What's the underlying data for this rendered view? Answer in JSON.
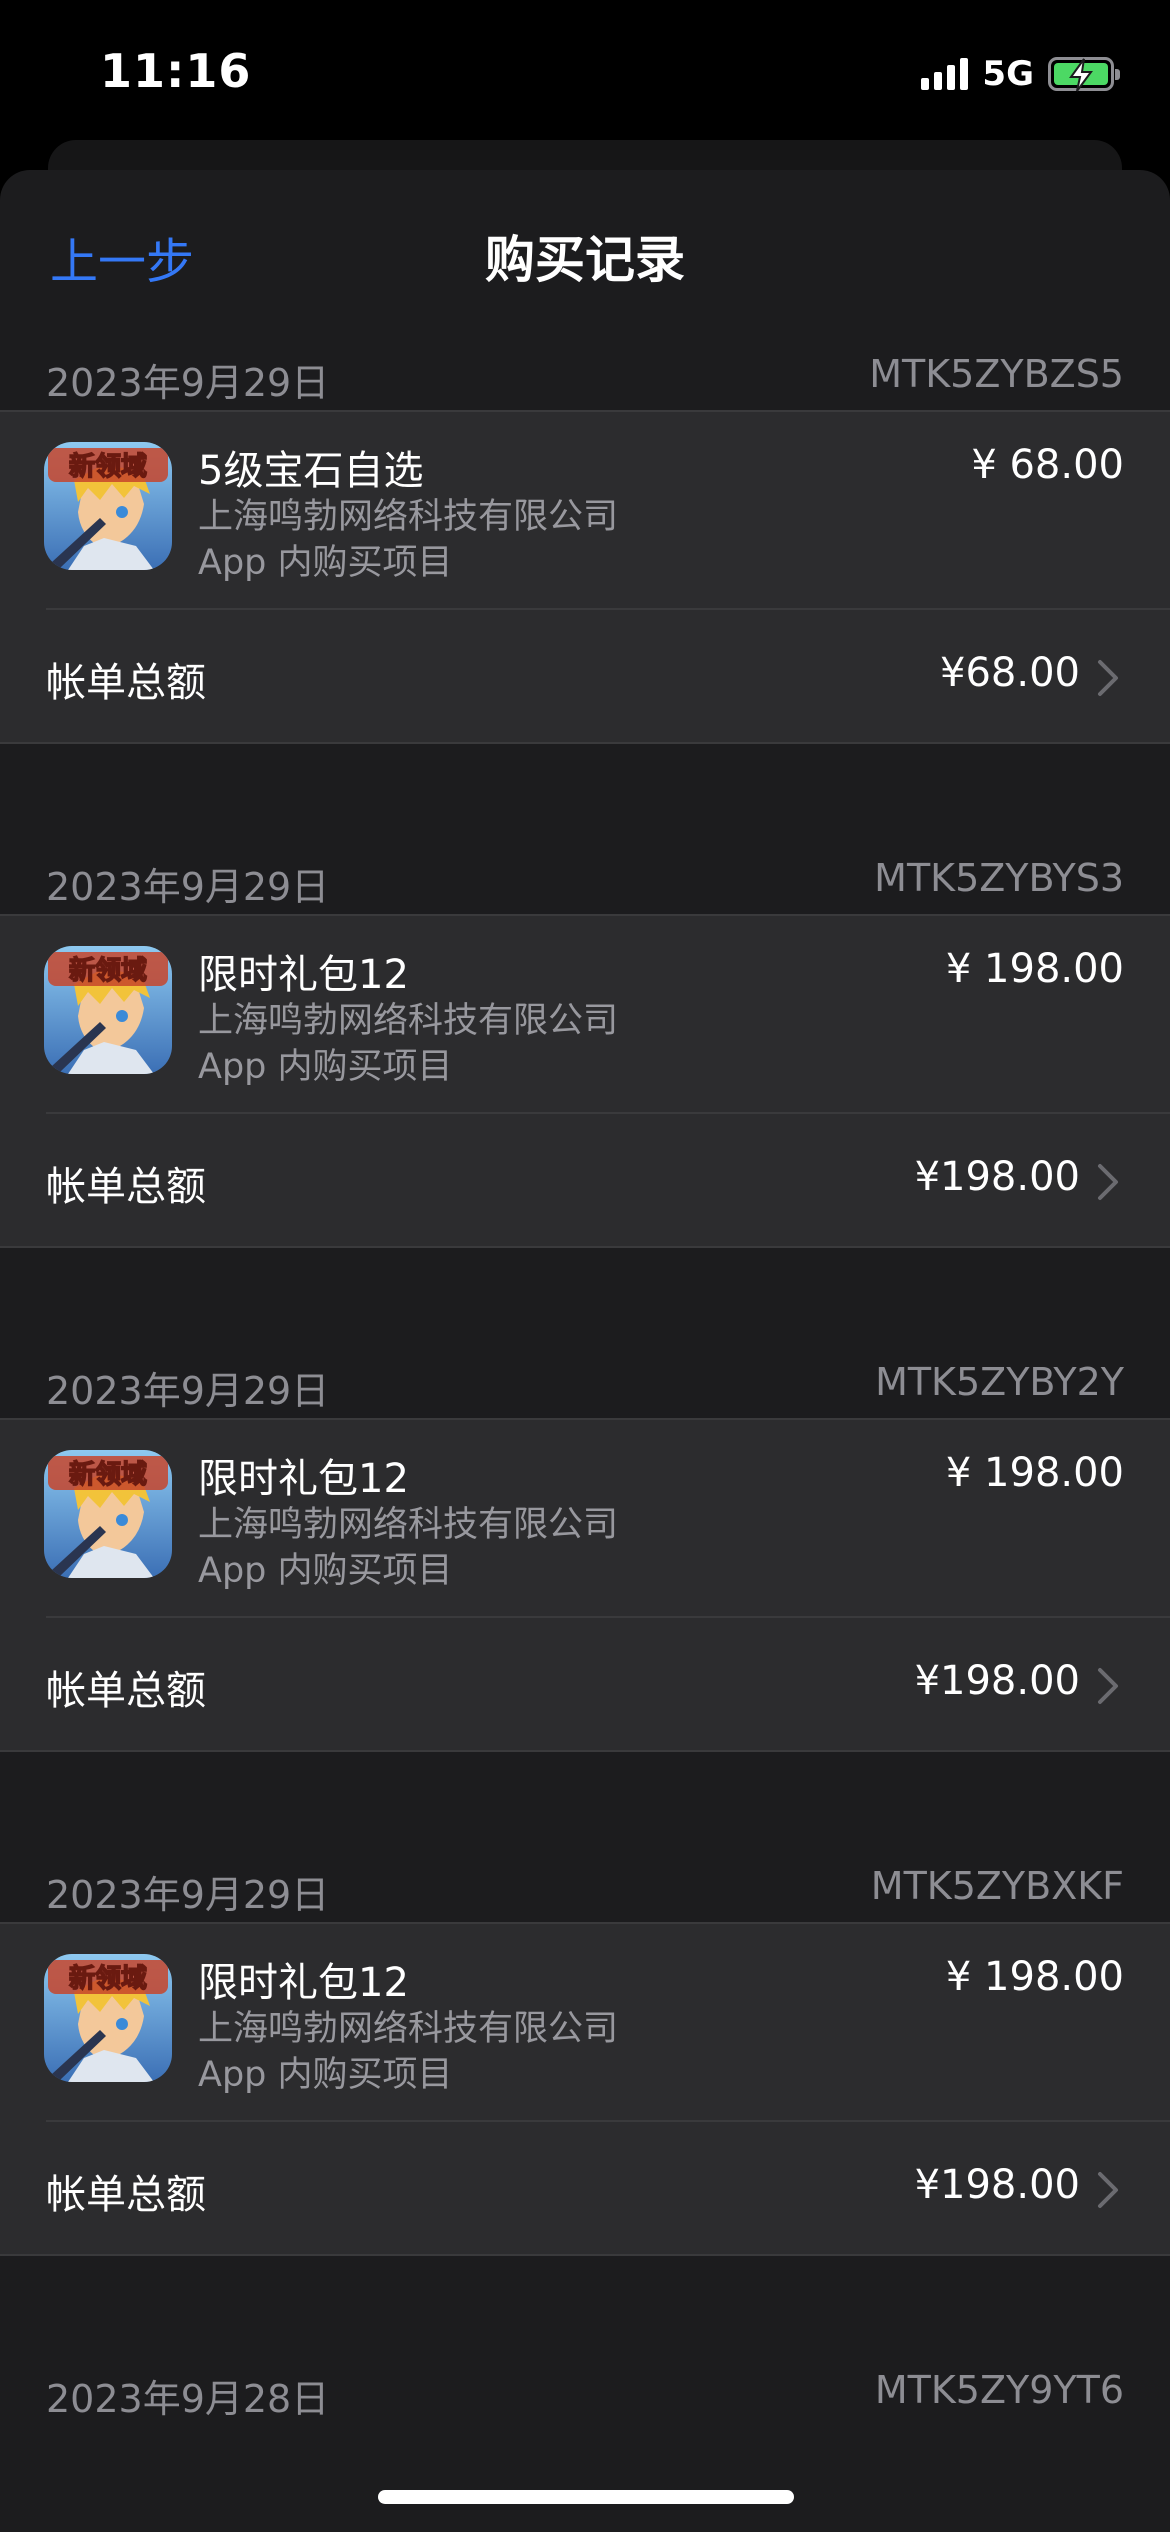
{
  "status_bar": {
    "time": "11:16",
    "network": "5G"
  },
  "nav": {
    "back_label": "上一步",
    "title": "购买记录"
  },
  "common": {
    "item_type": "App 内购买项目",
    "total_label": "帐单总额"
  },
  "groups": [
    {
      "date": "2023年9月29日",
      "order_id": "MTK5ZYBZS5",
      "item_name": "5级宝石自选",
      "seller": "上海鸣勃网络科技有限公司",
      "price": "¥ 68.00",
      "total": "¥68.00"
    },
    {
      "date": "2023年9月29日",
      "order_id": "MTK5ZYBYS3",
      "item_name": "限时礼包12",
      "seller": "上海鸣勃网络科技有限公司",
      "price": "¥ 198.00",
      "total": "¥198.00"
    },
    {
      "date": "2023年9月29日",
      "order_id": "MTK5ZYBY2Y",
      "item_name": "限时礼包12",
      "seller": "上海鸣勃网络科技有限公司",
      "price": "¥ 198.00",
      "total": "¥198.00"
    },
    {
      "date": "2023年9月29日",
      "order_id": "MTK5ZYBXKF",
      "item_name": "限时礼包12",
      "seller": "上海鸣勃网络科技有限公司",
      "price": "¥ 198.00",
      "total": "¥198.00"
    },
    {
      "date": "2023年9月28日",
      "order_id": "MTK5ZY9YT6"
    }
  ],
  "app_icon": {
    "logo_text": "新领域",
    "name": "game-app-icon"
  }
}
